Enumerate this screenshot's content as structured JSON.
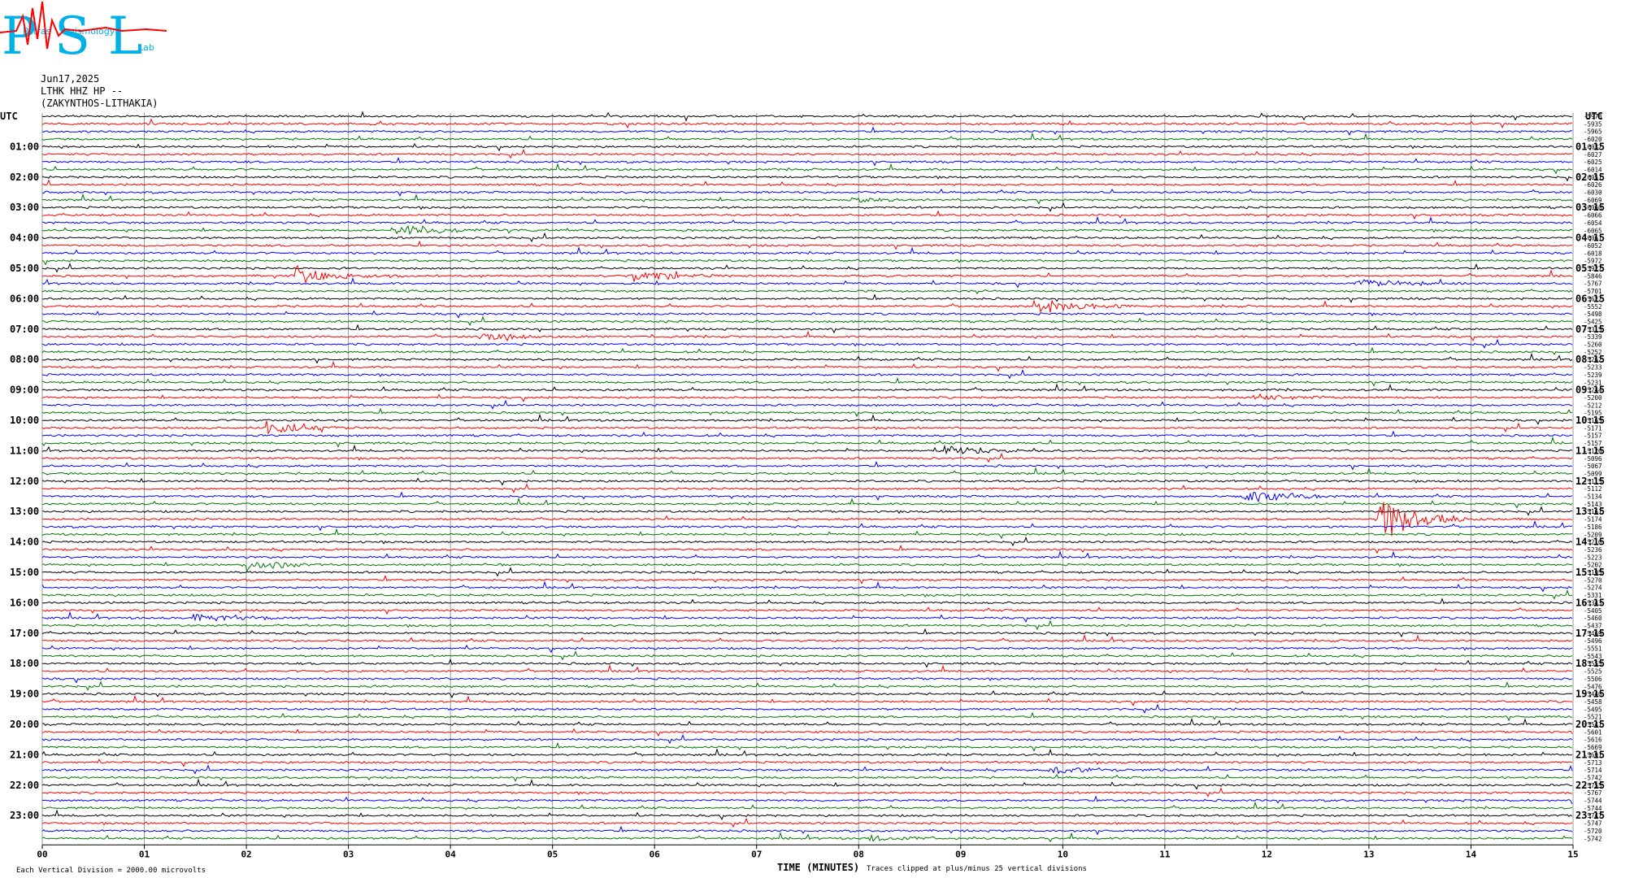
{
  "logo": {
    "text": "PSL",
    "small_words": [
      "Patras",
      "eismology",
      "Lab"
    ]
  },
  "header": {
    "date": "Jun17,2025",
    "station": "LTHK HHZ HP --",
    "location": "(ZAKYNTHOS-LITHAKIA)"
  },
  "axis": {
    "left_label": "UTC",
    "right_label": "UTC",
    "xlabel": "TIME (MINUTES)"
  },
  "footer": {
    "left_note": "Each Vertical Division = 2000.00 microvolts",
    "right_note": "Traces clipped at plus/minus 25 vertical divisions"
  },
  "colors": {
    "trace_cycle": [
      "#000000",
      "#ff0000",
      "#0000ff",
      "#007700"
    ],
    "grid": "#999999",
    "logo": "#00b0e8"
  },
  "chart_data": {
    "type": "line",
    "title": "",
    "xlabel": "TIME (MINUTES)",
    "ylabel": "",
    "x_ticks": [
      "00",
      "01",
      "02",
      "03",
      "04",
      "05",
      "06",
      "07",
      "08",
      "09",
      "10",
      "11",
      "12",
      "13",
      "14",
      "15"
    ],
    "xlim": [
      0,
      15
    ],
    "trace_minutes": 15,
    "trace_count": 96,
    "left_hour_labels": [
      "01:00",
      "02:00",
      "03:00",
      "04:00",
      "05:00",
      "06:00",
      "07:00",
      "08:00",
      "09:00",
      "10:00",
      "11:00",
      "12:00",
      "13:00",
      "14:00",
      "15:00",
      "16:00",
      "17:00",
      "18:00",
      "19:00",
      "20:00",
      "21:00",
      "22:00",
      "23:00"
    ],
    "right_hour_labels": [
      "01:15",
      "02:15",
      "03:15",
      "04:15",
      "05:15",
      "06:15",
      "07:15",
      "08:15",
      "09:15",
      "10:15",
      "11:15",
      "12:15",
      "13:15",
      "14:15",
      "15:15",
      "16:15",
      "17:15",
      "18:15",
      "19:15",
      "20:15",
      "21:15",
      "22:15",
      "23:15"
    ],
    "right_offsets": [
      "-5978",
      "-5935",
      "-5965",
      "-6020",
      "-6032",
      "-6027",
      "-6025",
      "-6014",
      "-6051",
      "-6026",
      "-6030",
      "-6069",
      "-6060",
      "-6066",
      "-6054",
      "-6065",
      "-6061",
      "-6052",
      "-6018",
      "-5972",
      "-5927",
      "-5846",
      "-5767",
      "-5701",
      "-5622",
      "-5552",
      "-5498",
      "-5425",
      "-5315",
      "-5339",
      "-5260",
      "-5252",
      "-5262",
      "-5233",
      "-5239",
      "-5231",
      "-5244",
      "-5200",
      "-5212",
      "-5195",
      "-5165",
      "-5171",
      "-5157",
      "-5157",
      "-5126",
      "-5096",
      "-5067",
      "-5099",
      "-5115",
      "-5112",
      "-5134",
      "-5143",
      "-5161",
      "-5174",
      "-5186",
      "-5209",
      "-5210",
      "-5236",
      "-5223",
      "-5202",
      "-5195",
      "-5270",
      "-5274",
      "-5331",
      "-5343",
      "-5405",
      "-5460",
      "-5437",
      "-5469",
      "-5496",
      "-5551",
      "-5543",
      "-5555",
      "-5525",
      "-5506",
      "-5476",
      "-5440",
      "-5458",
      "-5495",
      "-5521",
      "-5541",
      "-5601",
      "-5616",
      "-5669",
      "-5691",
      "-5713",
      "-5714",
      "-5742",
      "-5755",
      "-5767",
      "-5744",
      "-5744",
      "-5747",
      "-5747",
      "-5720",
      "-5742"
    ],
    "events": [
      {
        "trace": 11,
        "minute": 7.9,
        "amp": 3
      },
      {
        "trace": 15,
        "minute": 3.5,
        "amp": 9
      },
      {
        "trace": 21,
        "minute": 2.5,
        "amp": 14
      },
      {
        "trace": 21,
        "minute": 5.8,
        "amp": 10
      },
      {
        "trace": 22,
        "minute": 12.9,
        "amp": 8
      },
      {
        "trace": 25,
        "minute": 9.8,
        "amp": 12
      },
      {
        "trace": 29,
        "minute": 4.3,
        "amp": 6
      },
      {
        "trace": 37,
        "minute": 11.9,
        "amp": 5
      },
      {
        "trace": 41,
        "minute": 2.2,
        "amp": 10
      },
      {
        "trace": 44,
        "minute": 8.8,
        "amp": 8
      },
      {
        "trace": 50,
        "minute": 11.8,
        "amp": 10
      },
      {
        "trace": 53,
        "minute": 13.1,
        "amp": 38
      },
      {
        "trace": 59,
        "minute": 2.0,
        "amp": 9
      },
      {
        "trace": 66,
        "minute": 1.5,
        "amp": 8
      },
      {
        "trace": 86,
        "minute": 9.9,
        "amp": 6
      },
      {
        "trace": 95,
        "minute": 8.1,
        "amp": 5
      }
    ]
  }
}
